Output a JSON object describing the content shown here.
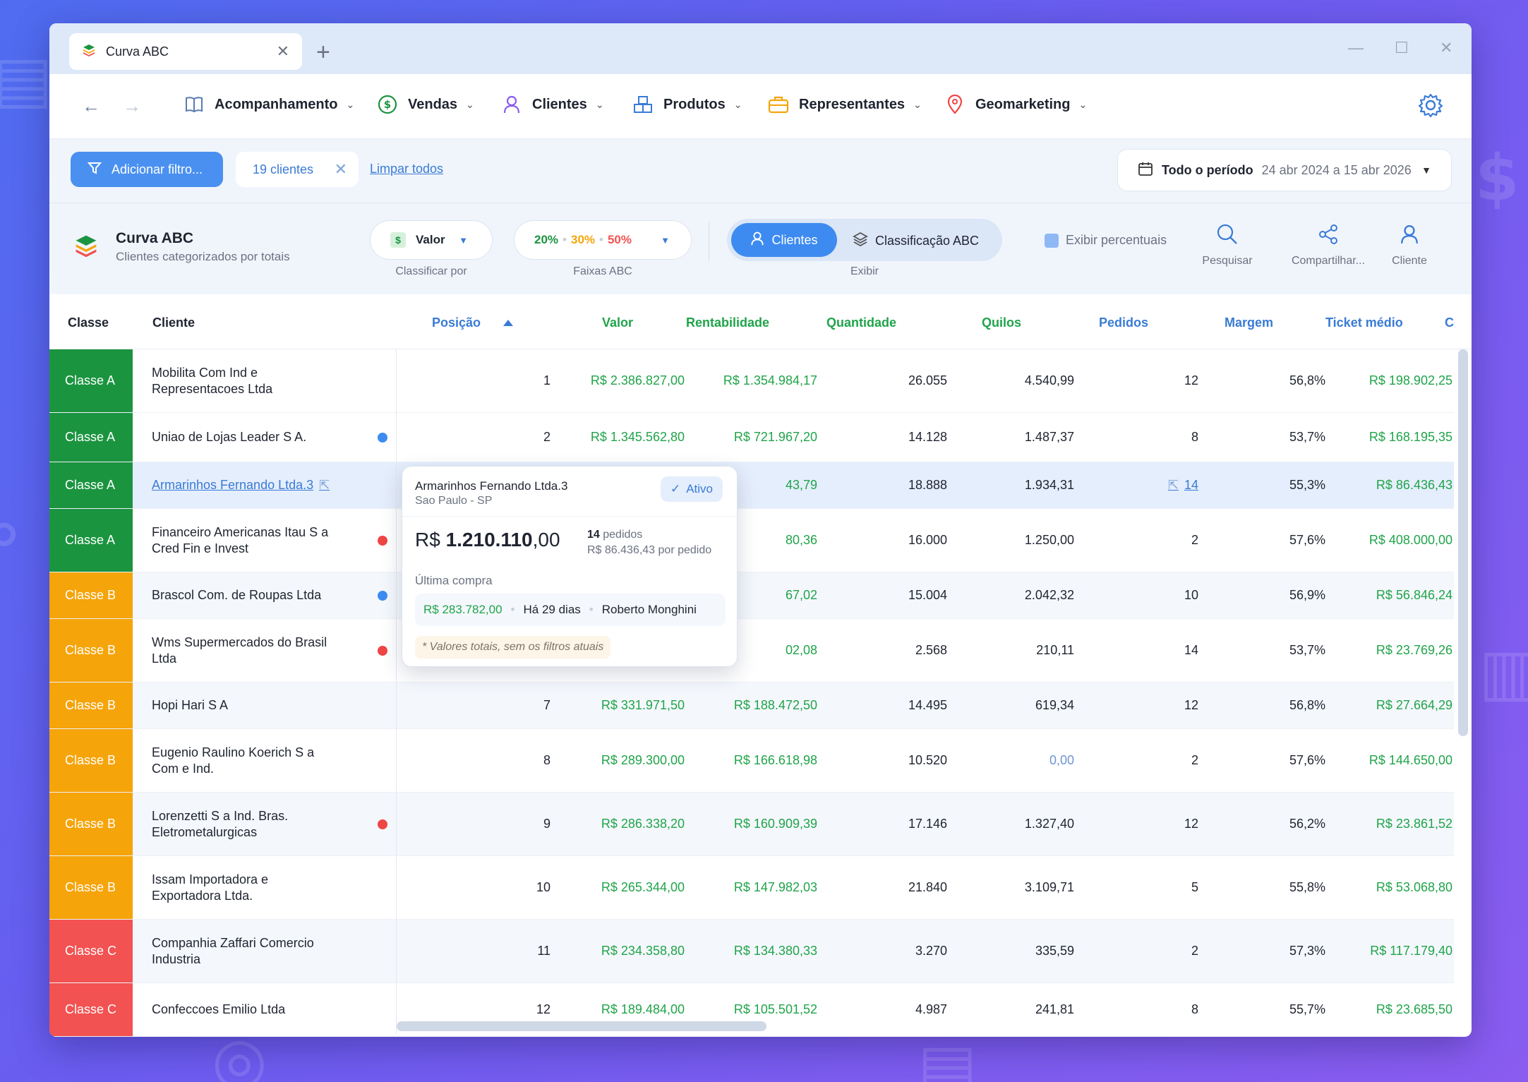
{
  "tab": {
    "title": "Curva ABC"
  },
  "nav": {
    "items": [
      {
        "label": "Acompanhamento",
        "icon": "book-icon"
      },
      {
        "label": "Vendas",
        "icon": "dollar-circle-icon"
      },
      {
        "label": "Clientes",
        "icon": "user-icon"
      },
      {
        "label": "Produtos",
        "icon": "boxes-icon"
      },
      {
        "label": "Representantes",
        "icon": "briefcase-icon"
      },
      {
        "label": "Geomarketing",
        "icon": "map-pin-icon"
      }
    ]
  },
  "filters": {
    "add_label": "Adicionar filtro...",
    "chip_label": "19 clientes",
    "clear_label": "Limpar todos",
    "period_label": "Todo o período",
    "period_range": "24 abr 2024 a 15 abr 2026"
  },
  "toolbar": {
    "title": "Curva ABC",
    "subtitle": "Clientes categorizados por totais",
    "sort_value": "Valor",
    "sort_caption": "Classificar por",
    "band_a": "20%",
    "band_b": "30%",
    "band_c": "50%",
    "band_caption": "Faixas ABC",
    "view_clientes": "Clientes",
    "view_abc": "Classificação ABC",
    "view_caption": "Exibir",
    "pct_toggle": "Exibir percentuais",
    "search": "Pesquisar",
    "share": "Compartilhar...",
    "client": "Cliente"
  },
  "table": {
    "headers": {
      "classe": "Classe",
      "cliente": "Cliente",
      "posicao": "Posição",
      "valor": "Valor",
      "rentabilidade": "Rentabilidade",
      "quantidade": "Quantidade",
      "quilos": "Quilos",
      "pedidos": "Pedidos",
      "margem": "Margem",
      "ticket": "Ticket médio",
      "extra": "Co"
    },
    "rows": [
      {
        "classe": "Classe A",
        "cliente": "Mobilita Com Ind e Representacoes Ltda",
        "posicao": "1",
        "valor": "R$ 2.386.827,00",
        "rentabilidade": "R$ 1.354.984,17",
        "quantidade": "26.055",
        "quilos": "4.540,99",
        "pedidos": "12",
        "margem": "56,8%",
        "ticket": "R$ 198.902,25"
      },
      {
        "classe": "Classe A",
        "cliente": "Uniao de Lojas Leader S A.",
        "posicao": "2",
        "valor": "R$ 1.345.562,80",
        "rentabilidade": "R$ 721.967,20",
        "quantidade": "14.128",
        "quilos": "1.487,37",
        "pedidos": "8",
        "margem": "53,7%",
        "ticket": "R$ 168.195,35"
      },
      {
        "classe": "Classe A",
        "cliente": "Armarinhos Fernando Ltda.3",
        "rentabilidade": "43,79",
        "quantidade": "18.888",
        "quilos": "1.934,31",
        "pedidos": "14",
        "margem": "55,3%",
        "ticket": "R$ 86.436,43"
      },
      {
        "classe": "Classe A",
        "cliente": "Financeiro Americanas Itau S a Cred Fin e Invest",
        "rentabilidade": "80,36",
        "quantidade": "16.000",
        "quilos": "1.250,00",
        "pedidos": "2",
        "margem": "57,6%",
        "ticket": "R$ 408.000,00"
      },
      {
        "classe": "Classe B",
        "cliente": "Brascol Com. de Roupas Ltda",
        "rentabilidade": "67,02",
        "quantidade": "15.004",
        "quilos": "2.042,32",
        "pedidos": "10",
        "margem": "56,9%",
        "ticket": "R$ 56.846,24"
      },
      {
        "classe": "Classe B",
        "cliente": "Wms Supermercados do Brasil Ltda",
        "rentabilidade": "02,08",
        "quantidade": "2.568",
        "quilos": "210,11",
        "pedidos": "14",
        "margem": "53,7%",
        "ticket": "R$ 23.769,26"
      },
      {
        "classe": "Classe B",
        "cliente": "Hopi Hari S A",
        "posicao": "7",
        "valor": "R$ 331.971,50",
        "rentabilidade": "R$ 188.472,50",
        "quantidade": "14.495",
        "quilos": "619,34",
        "pedidos": "12",
        "margem": "56,8%",
        "ticket": "R$ 27.664,29"
      },
      {
        "classe": "Classe B",
        "cliente": "Eugenio Raulino Koerich S a Com e Ind.",
        "posicao": "8",
        "valor": "R$ 289.300,00",
        "rentabilidade": "R$ 166.618,98",
        "quantidade": "10.520",
        "quilos": "0,00",
        "pedidos": "2",
        "margem": "57,6%",
        "ticket": "R$ 144.650,00"
      },
      {
        "classe": "Classe B",
        "cliente": "Lorenzetti S a Ind. Bras. Eletrometalurgicas",
        "posicao": "9",
        "valor": "R$ 286.338,20",
        "rentabilidade": "R$ 160.909,39",
        "quantidade": "17.146",
        "quilos": "1.327,40",
        "pedidos": "12",
        "margem": "56,2%",
        "ticket": "R$ 23.861,52"
      },
      {
        "classe": "Classe B",
        "cliente": "Issam Importadora e Exportadora Ltda.",
        "posicao": "10",
        "valor": "R$ 265.344,00",
        "rentabilidade": "R$ 147.982,03",
        "quantidade": "21.840",
        "quilos": "3.109,71",
        "pedidos": "5",
        "margem": "55,8%",
        "ticket": "R$ 53.068,80"
      },
      {
        "classe": "Classe C",
        "cliente": "Companhia Zaffari Comercio Industria",
        "posicao": "11",
        "valor": "R$ 234.358,80",
        "rentabilidade": "R$ 134.380,33",
        "quantidade": "3.270",
        "quilos": "335,59",
        "pedidos": "2",
        "margem": "57,3%",
        "ticket": "R$ 117.179,40"
      },
      {
        "classe": "Classe C",
        "cliente": "Confeccoes Emilio Ltda",
        "posicao": "12",
        "valor": "R$ 189.484,00",
        "rentabilidade": "R$ 105.501,52",
        "quantidade": "4.987",
        "quilos": "241,81",
        "pedidos": "8",
        "margem": "55,7%",
        "ticket": "R$ 23.685,50"
      }
    ]
  },
  "popup": {
    "name": "Armarinhos Fernando Ltda.3",
    "location": "Sao Paulo - SP",
    "status": "Ativo",
    "total_prefix": "R$",
    "total_main": "1.210.110",
    "total_cents": ",00",
    "orders_count": "14",
    "orders_label": "pedidos",
    "per_order": "R$ 86.436,43 por pedido",
    "last_label": "Última compra",
    "last_value": "R$ 283.782,00",
    "last_when": "Há 29 dias",
    "last_rep": "Roberto Monghini",
    "note": "* Valores totais, sem os filtros atuais"
  },
  "colors": {
    "accent": "#3d8bf0",
    "class_a": "#1b9440",
    "class_b": "#f5a40a",
    "class_c": "#f25252",
    "money_green": "#20a44a"
  }
}
